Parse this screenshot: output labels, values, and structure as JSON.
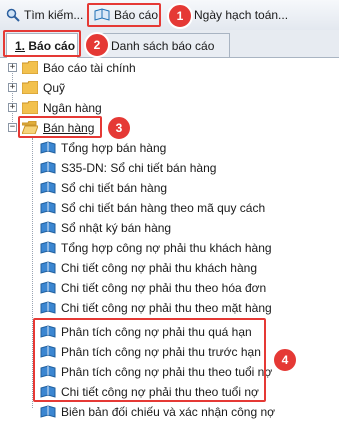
{
  "toolbar": {
    "search_label": "Tìm kiếm...",
    "report_label": "Báo cáo",
    "date_label": "Ngày hạch toán..."
  },
  "tabs": [
    {
      "label_num": "1.",
      "label_text": " Báo cáo"
    },
    {
      "label": "Danh sách báo cáo"
    }
  ],
  "tree": {
    "folders": [
      {
        "label": "Báo cáo tài chính",
        "expander": "+"
      },
      {
        "label": "Quỹ",
        "expander": "+"
      },
      {
        "label": "Ngân hàng",
        "expander": "+"
      },
      {
        "label": "Bán hàng",
        "expander": "−"
      }
    ],
    "reports": [
      "Tổng hợp bán hàng",
      "S35-DN: Sổ chi tiết bán hàng",
      "Sổ chi tiết bán hàng",
      "Sổ chi tiết bán hàng theo mã quy cách",
      "Sổ nhật ký bán hàng",
      "Tổng hợp công nợ phải thu khách hàng",
      "Chi tiết công nợ phải thu khách hàng",
      "Chi tiết công nợ phải thu theo hóa đơn",
      "Chi tiết công nợ phải thu theo mặt hàng",
      "Phân tích công nợ phải thu quá hạn",
      "Phân tích công nợ phải thu trước hạn",
      "Phân tích công nợ phải thu theo tuổi nợ",
      "Chi tiết công nợ phải thu theo tuổi nợ",
      "Biên bản đối chiếu và xác nhận công nợ"
    ]
  },
  "annotations": [
    "1",
    "2",
    "3",
    "4"
  ],
  "colors": {
    "highlight": "#e53935",
    "folder": "#f2c14e",
    "book": "#1f6fb5"
  }
}
